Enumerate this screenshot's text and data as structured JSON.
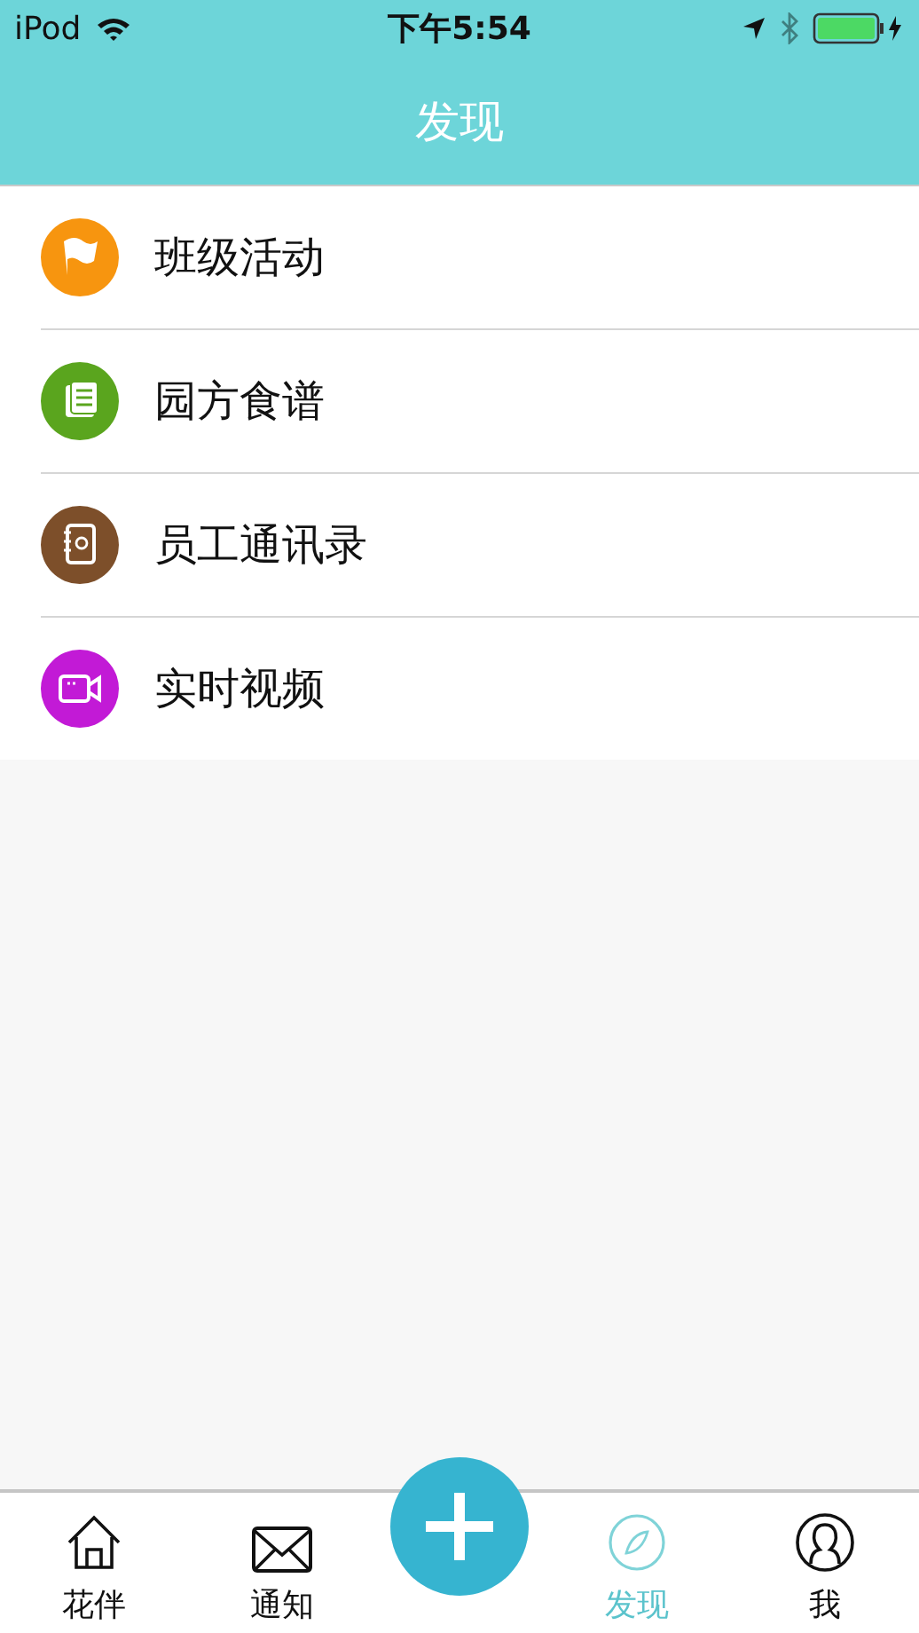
{
  "status_bar": {
    "carrier": "iPod",
    "time": "下午5:54"
  },
  "nav": {
    "title": "发现"
  },
  "items": [
    {
      "label": "班级活动",
      "kind": "flag",
      "color": "#f7950f"
    },
    {
      "label": "园方食谱",
      "kind": "book",
      "color": "#5aa51e"
    },
    {
      "label": "员工通讯录",
      "kind": "contacts",
      "color": "#7d4f2a"
    },
    {
      "label": "实时视频",
      "kind": "video",
      "color": "#c21ad6"
    }
  ],
  "tabs": [
    {
      "kind": "home",
      "label": "花伴",
      "selected": false
    },
    {
      "kind": "mail",
      "label": "通知",
      "selected": false
    },
    {
      "kind": "add",
      "selected": false
    },
    {
      "kind": "compass",
      "label": "发现",
      "selected": true
    },
    {
      "kind": "person",
      "label": "我",
      "selected": false
    }
  ]
}
